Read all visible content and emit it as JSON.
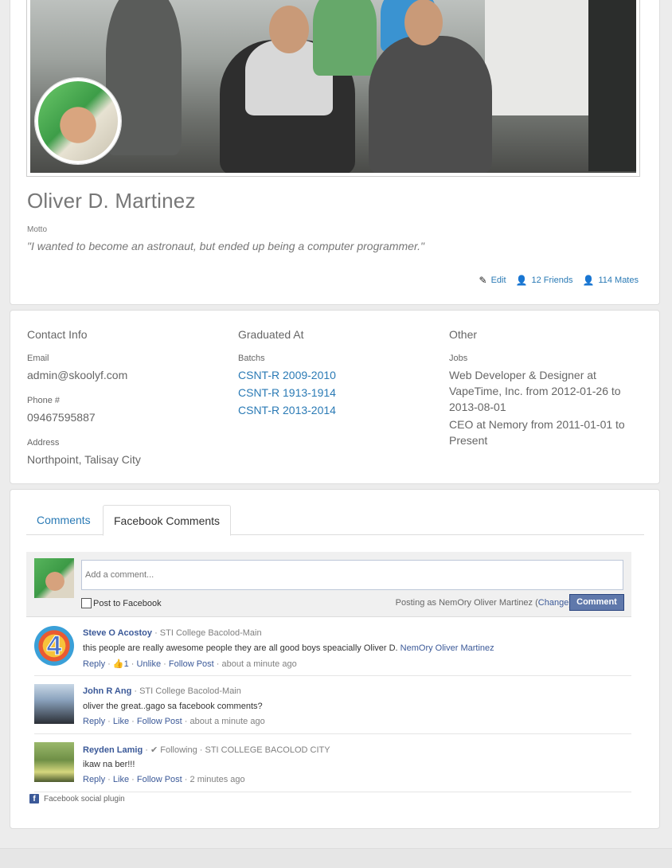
{
  "profile": {
    "name": "Oliver D. Martinez",
    "motto_label": "Motto",
    "motto": "\"I wanted to become an astronaut, but ended up being a computer programmer.\"",
    "actions": {
      "edit": "Edit",
      "friends": "12 Friends",
      "mates": "114 Mates"
    }
  },
  "contact": {
    "title": "Contact Info",
    "email_label": "Email",
    "email": "admin@skoolyf.com",
    "phone_label": "Phone #",
    "phone": "09467595887",
    "address_label": "Address",
    "address": "Northpoint, Talisay City"
  },
  "graduated": {
    "title": "Graduated At",
    "batches_label": "Batchs",
    "batches": [
      "CSNT-R 2009-2010",
      "CSNT-R 1913-1914",
      "CSNT-R 2013-2014"
    ]
  },
  "other": {
    "title": "Other",
    "jobs_label": "Jobs",
    "jobs": [
      "Web Developer & Designer at VapeTime, Inc. from 2012-01-26 to 2013-08-01",
      "CEO at Nemory from 2011-01-01 to Present"
    ]
  },
  "tabs": {
    "comments": "Comments",
    "facebook": "Facebook Comments"
  },
  "fb": {
    "placeholder": "Add a comment...",
    "post_to_facebook": "Post to Facebook",
    "posting_as_prefix": "Posting as NemOry Oliver Martinez (",
    "change": "Change",
    "posting_as_suffix": ")",
    "comment_button": "Comment",
    "plugin_label": "Facebook social plugin",
    "comments": [
      {
        "name": "Steve O Acostoy",
        "meta": " · STI College Bacolod-Main",
        "body": "this people are really awesome people they are all good boys speacially Oliver D. ",
        "body_link": "NemOry Oliver Martinez",
        "reply": "Reply",
        "like": "1",
        "like_action": "Unlike",
        "follow": "Follow Post",
        "time": "about a minute ago"
      },
      {
        "name": "John R Ang",
        "meta": " · STI College Bacolod-Main",
        "body": "oliver the great..gago sa facebook comments?",
        "reply": "Reply",
        "like_action": "Like",
        "follow": "Follow Post",
        "time": "about a minute ago"
      },
      {
        "name": "Reyden Lamig",
        "meta": " · ✔ Following · STI COLLEGE BACOLOD CITY",
        "body": "ikaw na ber!!!",
        "reply": "Reply",
        "like_action": "Like",
        "follow": "Follow Post",
        "time": "2 minutes ago"
      }
    ]
  }
}
